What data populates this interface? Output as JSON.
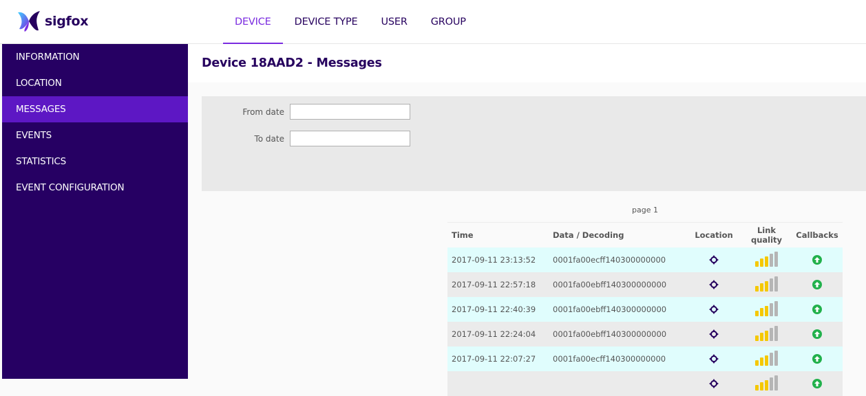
{
  "app": {
    "logo_text": "sigfox"
  },
  "nav": {
    "items": [
      {
        "label": "DEVICE",
        "active": true
      },
      {
        "label": "DEVICE TYPE",
        "active": false
      },
      {
        "label": "USER",
        "active": false
      },
      {
        "label": "GROUP",
        "active": false
      }
    ]
  },
  "sidebar": {
    "items": [
      {
        "label": "INFORMATION"
      },
      {
        "label": "LOCATION"
      },
      {
        "label": "MESSAGES",
        "active": true
      },
      {
        "label": "EVENTS"
      },
      {
        "label": "STATISTICS"
      },
      {
        "label": "EVENT CONFIGURATION"
      }
    ]
  },
  "page": {
    "title": "Device 18AAD2 - Messages"
  },
  "filter": {
    "from_label": "From date",
    "from_value": "",
    "to_label": "To date",
    "to_value": ""
  },
  "pager": {
    "text": "page 1"
  },
  "table": {
    "columns": [
      "Time",
      "Data / Decoding",
      "Location",
      "Link quality",
      "Callbacks"
    ],
    "rows": [
      {
        "time": "2017-09-11 23:13:52",
        "data": "0001fa00ecff140300000000",
        "location_icon": "crosshair-icon",
        "link_quality": 3,
        "link_quality_max": 5,
        "callback_icon": "arrow-up-circle-icon"
      },
      {
        "time": "2017-09-11 22:57:18",
        "data": "0001fa00ebff140300000000",
        "location_icon": "crosshair-icon",
        "link_quality": 3,
        "link_quality_max": 5,
        "callback_icon": "arrow-up-circle-icon"
      },
      {
        "time": "2017-09-11 22:40:39",
        "data": "0001fa00ebff140300000000",
        "location_icon": "crosshair-icon",
        "link_quality": 3,
        "link_quality_max": 5,
        "callback_icon": "arrow-up-circle-icon"
      },
      {
        "time": "2017-09-11 22:24:04",
        "data": "0001fa00ebff140300000000",
        "location_icon": "crosshair-icon",
        "link_quality": 3,
        "link_quality_max": 5,
        "callback_icon": "arrow-up-circle-icon"
      },
      {
        "time": "2017-09-11 22:07:27",
        "data": "0001fa00ecff140300000000",
        "location_icon": "crosshair-icon",
        "link_quality": 3,
        "link_quality_max": 5,
        "callback_icon": "arrow-up-circle-icon"
      },
      {
        "time": "",
        "data": "",
        "location_icon": "crosshair-icon",
        "link_quality": 3,
        "link_quality_max": 5,
        "callback_icon": "arrow-up-circle-icon"
      }
    ]
  },
  "colors": {
    "brand_dark": "#26005e",
    "accent": "#7a2be0",
    "sidebar_bg": "#260063",
    "sidebar_active": "#5d17c4",
    "row_odd": "#e0fdfd",
    "row_even": "#ebebeb",
    "signal_on": "#f5c800",
    "signal_off": "#b5b5b5",
    "callback_ok": "#22b14c"
  }
}
